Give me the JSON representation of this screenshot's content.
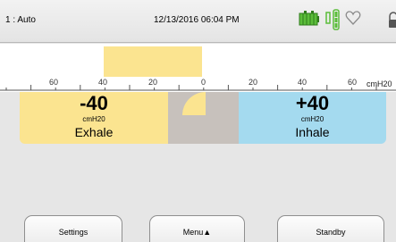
{
  "header": {
    "mode": "1 : Auto",
    "datetime": "12/13/2016 06:04 PM"
  },
  "colors": {
    "exhale": "#fbe490",
    "inhale": "#a4daef",
    "neutral": "#c7c1bc",
    "battery_green": "#5bbd3a"
  },
  "gauge": {
    "tick_labels": [
      "60",
      "40",
      "20",
      "0",
      "20",
      "40",
      "60"
    ],
    "unit": "cmH20",
    "bar_range": [
      -40,
      0
    ]
  },
  "exhale": {
    "value": "-40",
    "unit": "cmH20",
    "label": "Exhale"
  },
  "inhale": {
    "value": "+40",
    "unit": "cmH20",
    "label": "Inhale"
  },
  "buttons": {
    "settings": "Settings",
    "menu": "Menu▲",
    "standby": "Standby"
  },
  "icons": [
    "battery-icon",
    "plug-icon",
    "heart-icon",
    "lock-icon"
  ]
}
